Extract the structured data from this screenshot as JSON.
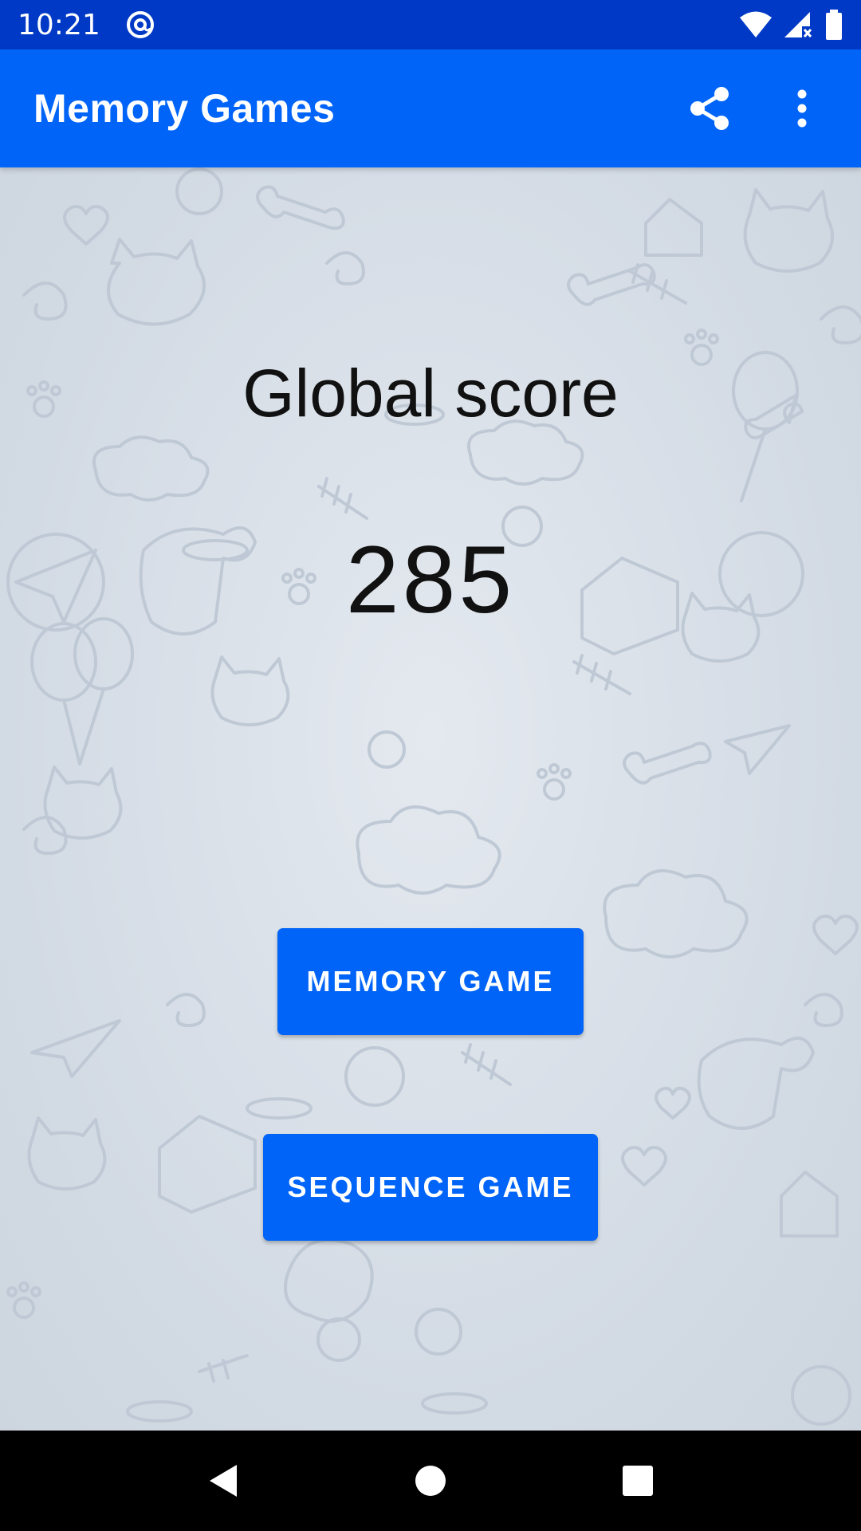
{
  "status_bar": {
    "time": "10:21",
    "app_icon": "at-sign-icon",
    "icons": [
      "wifi-icon",
      "signal-icon",
      "battery-icon"
    ]
  },
  "app_bar": {
    "title": "Memory Games",
    "actions": [
      "share-icon",
      "more-vert-icon"
    ]
  },
  "main": {
    "score_title": "Global score",
    "score_value": "285",
    "buttons": {
      "memory_game": "MEMORY GAME",
      "sequence_game": "SEQUENCE GAME"
    }
  },
  "nav_bar": {
    "buttons": [
      "back-icon",
      "home-icon",
      "recents-icon"
    ]
  },
  "colors": {
    "status_bar": "#0039c6",
    "primary": "#0064f8",
    "background": "#d6dde6",
    "text": "#111111"
  }
}
